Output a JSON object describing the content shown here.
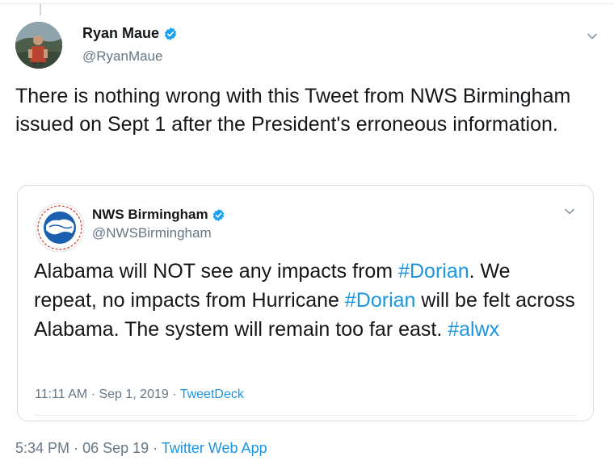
{
  "colors": {
    "link": "#1b95e0",
    "secondary": "#657786",
    "verified": "#1da1f2"
  },
  "tweet": {
    "display_name": "Ryan Maue",
    "handle": "@RyanMaue",
    "verified_icon": "verified-badge-icon",
    "text": "There is nothing wrong with this Tweet from NWS Birmingham issued on Sept 1 after the President's erroneous information.",
    "timestamp": "5:34 PM",
    "dot": "·",
    "date": "06 Sep 19",
    "source": "Twitter Web App"
  },
  "quoted": {
    "display_name": "NWS Birmingham",
    "handle": "@NWSBirmingham",
    "logo_icon": "nws-logo-icon",
    "logo_text": "NATIONAL WEATHER SERVICE",
    "text_segments": [
      {
        "text": "Alabama will NOT see any impacts from ",
        "hashtag": false
      },
      {
        "text": "#Dorian",
        "hashtag": true
      },
      {
        "text": ". We repeat, no impacts from Hurricane ",
        "hashtag": false
      },
      {
        "text": "#Dorian",
        "hashtag": true
      },
      {
        "text": " will be felt across Alabama. The system will remain too far east. ",
        "hashtag": false
      },
      {
        "text": "#alwx",
        "hashtag": true
      }
    ],
    "timestamp": "11:11 AM",
    "dot": "·",
    "date": "Sep 1, 2019",
    "source": "TweetDeck"
  }
}
